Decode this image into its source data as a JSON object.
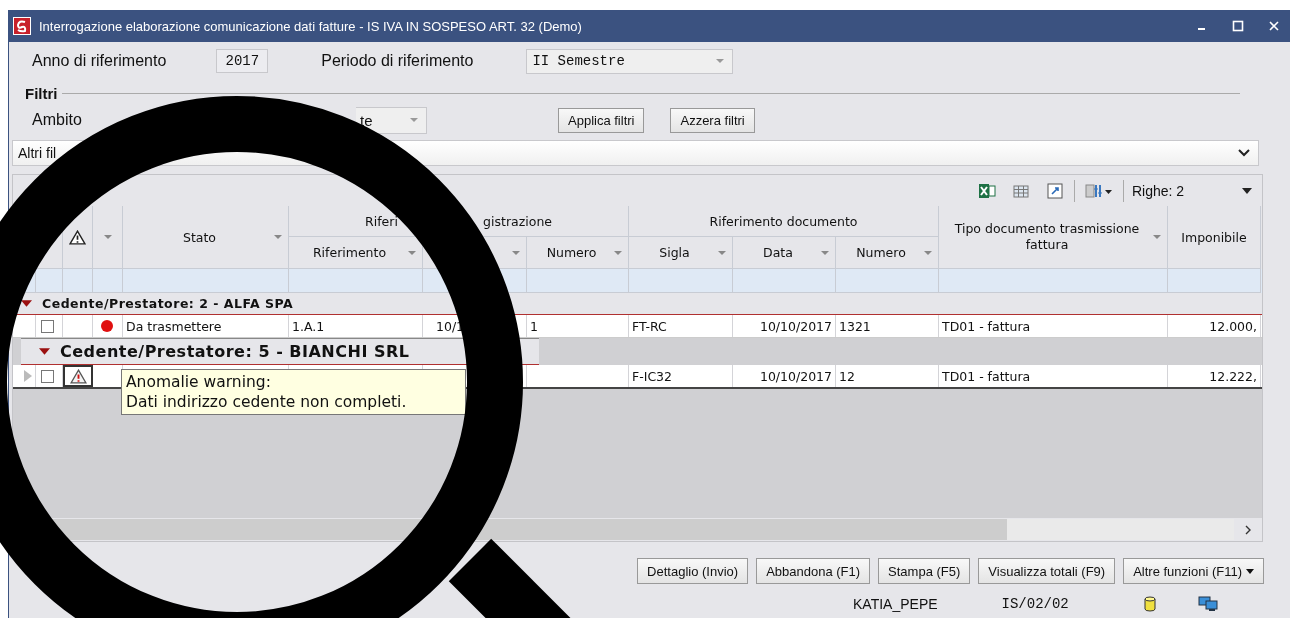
{
  "window": {
    "title": "Interrogazione elaborazione comunicazione dati fatture - IS IVA IN SOSPESO ART. 32  (Demo)"
  },
  "header": {
    "year_label": "Anno di riferimento",
    "year": "2017",
    "period_label": "Periodo di riferimento",
    "period": "II Semestre"
  },
  "filters": {
    "title": "Filtri",
    "scope_label": "Ambito",
    "scope_value": "te",
    "apply": "Applica filtri",
    "reset": "Azzera filtri",
    "other_filters": "Altri fil"
  },
  "grid": {
    "rows_label": "Righe: 2",
    "columns": {
      "stato": "Stato",
      "reg_group_left": "Riferi",
      "reg_group_right": "gistrazione",
      "riferimento": "Riferimento",
      "numero_reg": "Numero",
      "doc_group": "Riferimento documento",
      "sigla": "Sigla",
      "data_doc": "Data",
      "numero_doc": "Numero",
      "tipo": "Tipo documento trasmissione fattura",
      "imponibile": "Imponibile"
    },
    "groups": [
      {
        "label": "Cedente/Prestatore: 2 - ALFA SPA",
        "expanded": true,
        "magnified": false,
        "rows": [
          {
            "current": false,
            "checked": false,
            "warning": false,
            "color": "#e01010",
            "status": "Da trasmettere",
            "cells": {
              "riferimento": "1.A.1",
              "data_reg": "10/1",
              "numero_reg": "1",
              "sigla": "FT-RC",
              "data_doc": "10/10/2017",
              "numero_doc": "1321",
              "tipo": "TD01 - fattura",
              "imponibile": "12.000,"
            }
          }
        ]
      },
      {
        "label": "Cedente/Prestatore: 5 - BIANCHI SRL",
        "expanded": true,
        "magnified": true,
        "rows": [
          {
            "current": true,
            "checked": false,
            "warning": true,
            "cells": {
              "sigla": "F-IC32",
              "data_doc": "10/10/2017",
              "numero_doc": "12",
              "tipo": "TD01 - fattura",
              "imponibile": "12.222,"
            }
          }
        ]
      }
    ],
    "tooltip": {
      "text": "Anomalie warning:\nDati indirizzo cedente non completi."
    }
  },
  "buttons": [
    {
      "label": "Dettaglio (Invio)",
      "kind": "plain"
    },
    {
      "label": "Abbandona (F1)",
      "kind": "plain"
    },
    {
      "label": "Stampa (F5)",
      "kind": "plain"
    },
    {
      "label": "Visualizza totali (F9)",
      "kind": "plain"
    },
    {
      "label": "Altre funzioni (F11)",
      "kind": "menu"
    }
  ],
  "status_bar": {
    "user": "KATIA_PEPE",
    "code": "IS/02/02"
  }
}
